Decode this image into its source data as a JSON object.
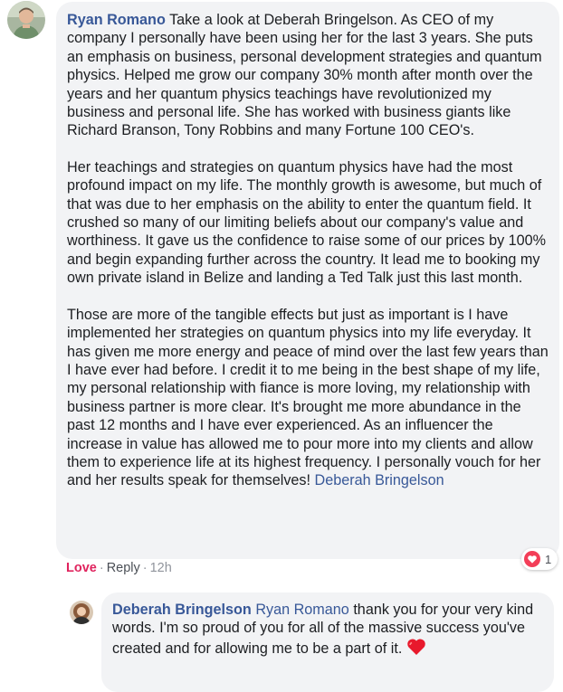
{
  "main_comment": {
    "author": "Ryan Romano",
    "paragraphs": [
      "Take a look at Deberah Bringelson. As CEO of my company I personally have been using her for the last 3 years. She puts an emphasis on business, personal development strategies and quantum physics. Helped me grow our company 30% month after month over the years and her quantum physics teachings have revolutionized my business and personal life. She has worked with business giants like Richard Branson, Tony Robbins and many Fortune 100 CEO's.",
      "Her teachings and strategies on quantum physics have had the most profound impact on my life. The monthly growth is awesome, but much of that was due to her emphasis on the ability to enter the quantum field. It crushed so many of our limiting beliefs about our company's value and worthiness. It gave us the confidence to raise some of our prices by 100% and begin expanding further across the country. It lead me to booking my own private island in Belize and landing a Ted Talk just this last month.",
      "Those are more of the tangible effects but just as important is I have implemented her strategies on quantum physics into my life everyday. It has given me more energy and peace of mind over the last few years than I have ever had before. I credit it to me being in the best shape of my life, my personal relationship with fiance is more loving, my relationship with business partner is more clear. It's brought me more abundance in the past 12 months and I have ever experienced. As an influencer the increase in value has allowed me to pour more into my clients and allow them to experience life at its highest frequency. I personally vouch for her and her results speak for themselves!"
    ],
    "tag": "Deberah Bringelson",
    "actions": {
      "love": "Love",
      "reply": "Reply",
      "time": "12h"
    },
    "reactions": {
      "icon": "heart-reaction-icon",
      "count": "1",
      "color": "#f33e58"
    }
  },
  "reply_comment": {
    "author": "Deberah Bringelson",
    "mention": "Ryan Romano",
    "text": "thank you for your very kind words. I'm so proud of you for all of the massive success you've created and for allowing me to be a part of it.",
    "emoji": "red-heart-icon"
  },
  "colors": {
    "link": "#385898",
    "love": "#e0245e",
    "bubble": "#f2f3f5",
    "meta": "#90949c"
  }
}
